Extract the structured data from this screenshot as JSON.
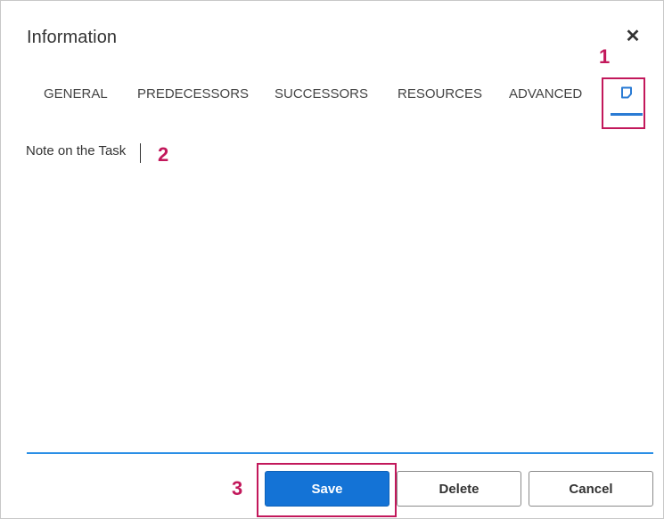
{
  "dialog": {
    "title": "Information",
    "close_symbol": "✕"
  },
  "tabs": {
    "items": [
      {
        "label": "GENERAL"
      },
      {
        "label": "PREDECESSORS"
      },
      {
        "label": "SUCCESSORS"
      },
      {
        "label": "RESOURCES"
      },
      {
        "label": "ADVANCED"
      }
    ],
    "active": {
      "icon": "note-icon",
      "selected": true
    }
  },
  "note": {
    "value": "Note on the Task"
  },
  "buttons": {
    "save_label": "Save",
    "delete_label": "Delete",
    "cancel_label": "Cancel"
  },
  "callouts": [
    "1",
    "2",
    "3"
  ],
  "colors": {
    "accent": "#2a7bd4",
    "primary_button": "#1473d6",
    "callout": "#c2185b",
    "divider": "#2a8fe6"
  }
}
